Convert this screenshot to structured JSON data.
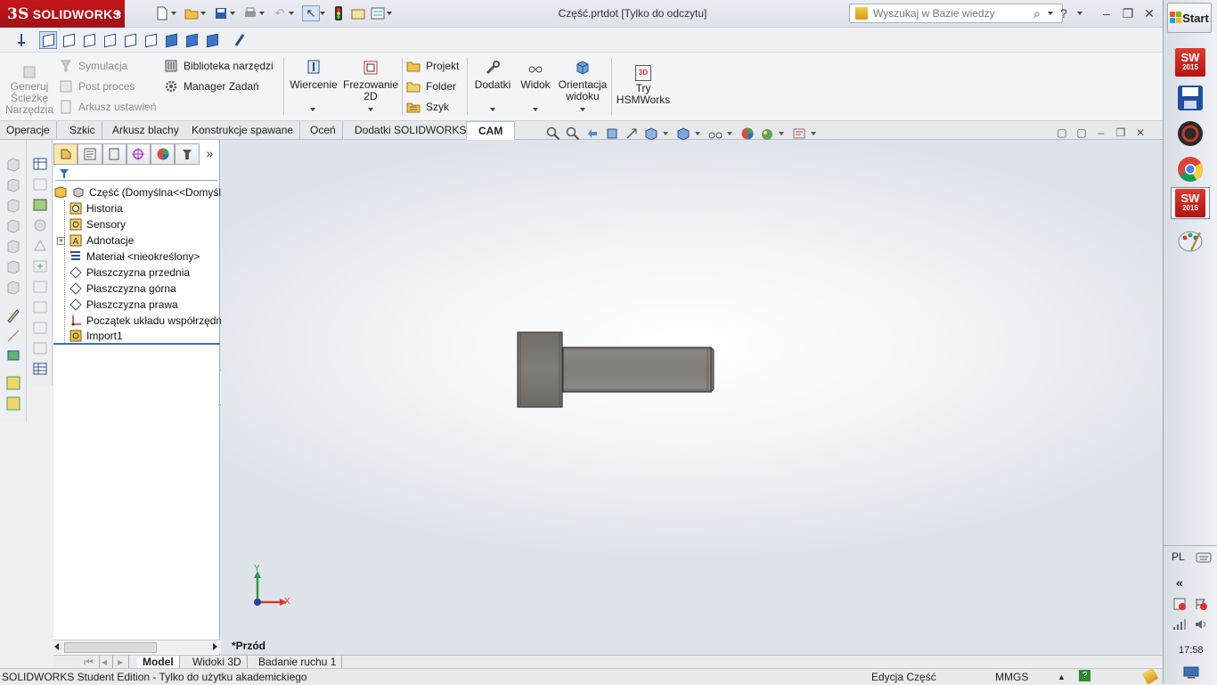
{
  "app": {
    "brand": "SOLIDWORKS",
    "brand_mark": "3S",
    "doc_title": "Część.prtdot [Tylko do odczytu]"
  },
  "search": {
    "placeholder": "Wyszukaj w Bazie wiedzy",
    "help": "?"
  },
  "window": {
    "minimize": "–",
    "restore": "❐",
    "close": "✕"
  },
  "cam_commands": {
    "generate_toolpaths": "Generuj Ścieżkę Narzędzia",
    "simulation": "Symulacja",
    "post_process": "Post proces",
    "setup_sheet": "Arkusz ustawień",
    "tool_library": "Biblioteka narzędzi",
    "task_manager": "Manager Zadań",
    "drilling": "Wiercenie",
    "milling_2d": "Frezowanie 2D",
    "project": "Projekt",
    "folder": "Folder",
    "pattern": "Szyk",
    "addins": "Dodatki",
    "view": "Widok",
    "view_orientation": "Orientacja widoku",
    "try_hsm": "Try HSMWorks",
    "hsm_badge": "3D"
  },
  "tabs": [
    {
      "label": "Operacje"
    },
    {
      "label": "Szkic"
    },
    {
      "label": "Arkusz blachy"
    },
    {
      "label": "Konstrukcje spawane"
    },
    {
      "label": "Oceń"
    },
    {
      "label": "Dodatki SOLIDWORKS"
    },
    {
      "label": "CAM"
    }
  ],
  "active_tab": "CAM",
  "feature_tree": {
    "more": "»",
    "root": "Część  (Domyślna<<Domyślna>",
    "items": [
      {
        "label": "Historia"
      },
      {
        "label": "Sensory"
      },
      {
        "label": "Adnotacje",
        "expand": "+"
      },
      {
        "label": "Materiał <nieokreślony>"
      },
      {
        "label": "Płaszczyzna przednia"
      },
      {
        "label": "Płaszczyzna górna"
      },
      {
        "label": "Płaszczyzna prawa"
      },
      {
        "label": "Początek układu współrzędnych"
      },
      {
        "label": "Import1"
      }
    ]
  },
  "viewport": {
    "view_label": "*Przód",
    "axis_y": "Y",
    "axis_x": "X"
  },
  "bottom_tabs": [
    {
      "label": "Model"
    },
    {
      "label": "Widoki 3D"
    },
    {
      "label": "Badanie ruchu 1"
    }
  ],
  "status": {
    "edition": "SOLIDWORKS Student Edition - Tylko do użytku akademickiego",
    "mode": "Edycja Część",
    "units": "MMGS",
    "help": "?"
  },
  "taskbar": {
    "start": "Start",
    "sw_label": "SW",
    "sw_year": "2015",
    "language": "PL",
    "collapse": "«",
    "clock": "17:58"
  },
  "colors": {
    "brand_red": "#b31217",
    "accent_blue": "#2d4f86",
    "model_gray": "#7d7a76"
  }
}
